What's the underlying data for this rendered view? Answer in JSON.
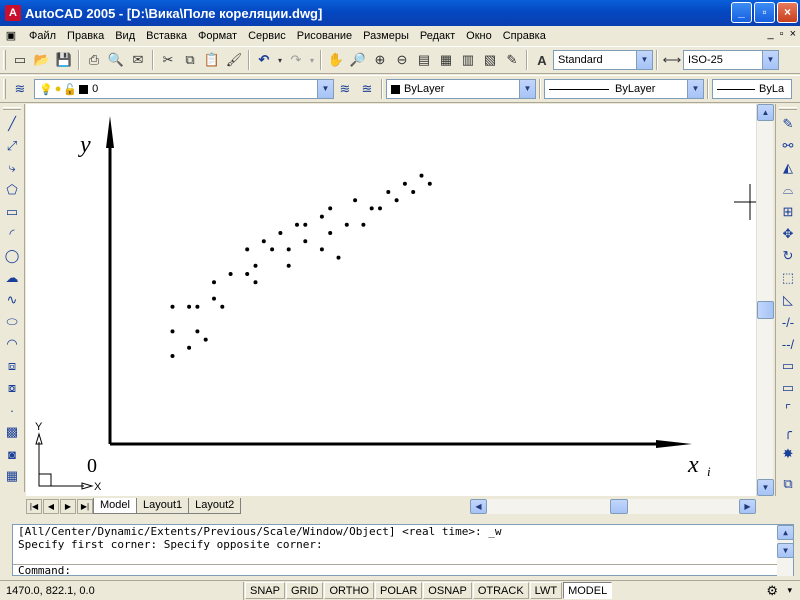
{
  "window": {
    "app_icon_letter": "A",
    "title": "AutoCAD 2005 - [D:\\Вика\\Поле кореляции.dwg]",
    "minimize": "_",
    "maximize": "▫",
    "close": "×"
  },
  "menu": {
    "items": [
      "Файл",
      "Правка",
      "Вид",
      "Вставка",
      "Формат",
      "Сервис",
      "Рисование",
      "Размеры",
      "Редакт",
      "Окно",
      "Справка"
    ],
    "doc_min": "_",
    "doc_restore": "▫",
    "doc_close": "×"
  },
  "toolbar1": {
    "text_style": "Standard",
    "dim_style": "ISO-25"
  },
  "toolbar2": {
    "layer_name": "0",
    "color": "ByLayer",
    "linetype": "ByLayer",
    "lineweight": "ByLa"
  },
  "drawing": {
    "y_label": "y",
    "x_label": "x",
    "x_subscript": "i",
    "origin_label": "0",
    "ucs_y": "Y",
    "ucs_x": "X"
  },
  "layout_tabs": [
    "Model",
    "Layout1",
    "Layout2"
  ],
  "command": {
    "line1": "[All/Center/Dynamic/Extents/Previous/Scale/Window/Object] <real time>: _w",
    "line2": "Specify first corner: Specify opposite corner:",
    "prompt": "Command:"
  },
  "status": {
    "coords": "1470.0, 822.1, 0.0",
    "buttons": [
      {
        "label": "SNAP",
        "on": false
      },
      {
        "label": "GRID",
        "on": false
      },
      {
        "label": "ORTHO",
        "on": false
      },
      {
        "label": "POLAR",
        "on": false
      },
      {
        "label": "OSNAP",
        "on": false
      },
      {
        "label": "OTRACK",
        "on": false
      },
      {
        "label": "LWT",
        "on": false
      },
      {
        "label": "MODEL",
        "on": true
      }
    ]
  },
  "chart_data": {
    "type": "scatter",
    "title": "",
    "xlabel": "x_i",
    "ylabel": "y",
    "points": [
      [
        5,
        14
      ],
      [
        5,
        17
      ],
      [
        5,
        20
      ],
      [
        7,
        15
      ],
      [
        7,
        20
      ],
      [
        8,
        17
      ],
      [
        8,
        20
      ],
      [
        9,
        16
      ],
      [
        10,
        21
      ],
      [
        10,
        23
      ],
      [
        11,
        20
      ],
      [
        12,
        24
      ],
      [
        14,
        24
      ],
      [
        14,
        27
      ],
      [
        15,
        23
      ],
      [
        15,
        25
      ],
      [
        16,
        28
      ],
      [
        17,
        27
      ],
      [
        18,
        29
      ],
      [
        19,
        25
      ],
      [
        19,
        27
      ],
      [
        20,
        30
      ],
      [
        21,
        28
      ],
      [
        21,
        30
      ],
      [
        23,
        27
      ],
      [
        23,
        31
      ],
      [
        24,
        29
      ],
      [
        24,
        32
      ],
      [
        25,
        26
      ],
      [
        26,
        30
      ],
      [
        27,
        33
      ],
      [
        28,
        30
      ],
      [
        29,
        32
      ],
      [
        30,
        32
      ],
      [
        31,
        34
      ],
      [
        32,
        33
      ],
      [
        33,
        35
      ],
      [
        34,
        34
      ],
      [
        35,
        36
      ],
      [
        36,
        35
      ]
    ]
  }
}
